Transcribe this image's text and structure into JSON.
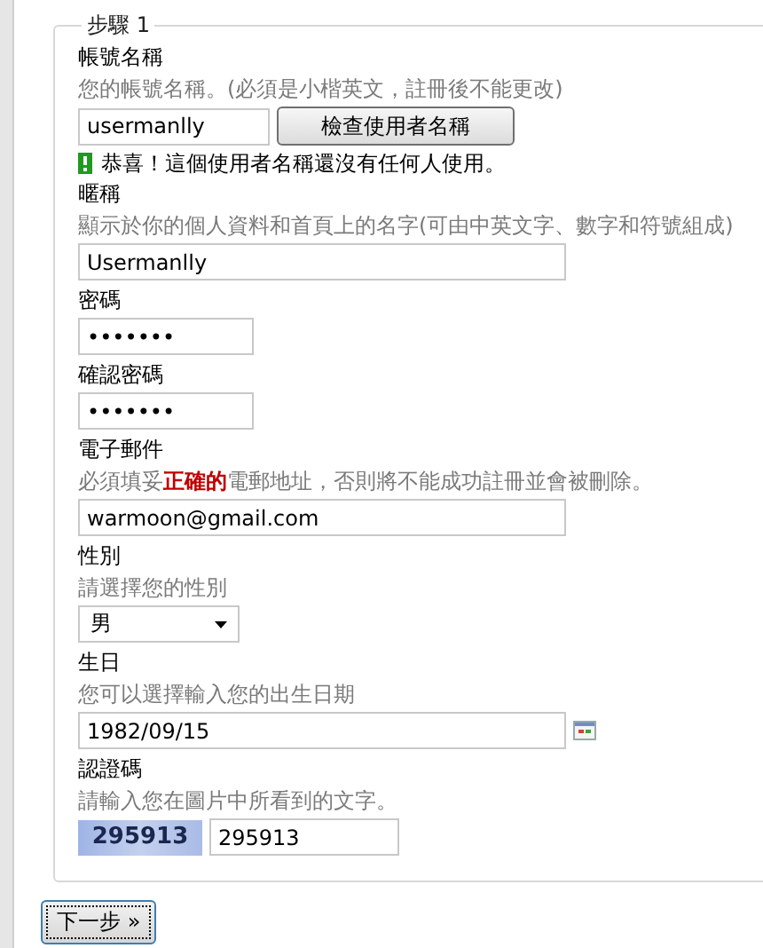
{
  "step_legend": "步驟 1",
  "fields": [
    {
      "kind": "username",
      "label": "帳號名稱",
      "hint": "您的帳號名稱。(必須是小楷英文，註冊後不能更改)",
      "value": "usermanlly",
      "button": "檢查使用者名稱",
      "message": "恭喜！這個使用者名稱還沒有任何人使用。"
    },
    {
      "kind": "wide",
      "label": "暱稱",
      "hint": "顯示於你的個人資料和首頁上的名字(可由中英文字、數字和符號組成)",
      "value": "Usermanlly"
    },
    {
      "kind": "password",
      "label": "密碼",
      "value": "•••••••"
    },
    {
      "kind": "password",
      "label": "確認密碼",
      "value": "•••••••"
    },
    {
      "kind": "wide",
      "label": "電子郵件",
      "hint": "必須填妥**正確的**電郵地址，否則將不能成功註冊並會被刪除。",
      "value": "warmoon@gmail.com"
    },
    {
      "kind": "select",
      "label": "性別",
      "hint": "請選擇您的性別",
      "value": "男"
    },
    {
      "kind": "date",
      "label": "生日",
      "hint": "您可以選擇輸入您的出生日期",
      "value": "1982/09/15"
    },
    {
      "kind": "captcha",
      "label": "認證碼",
      "hint": "請輸入您在圖片中所看到的文字。",
      "captcha": "295913",
      "value": "295913"
    }
  ],
  "next_button": "下一步 »"
}
